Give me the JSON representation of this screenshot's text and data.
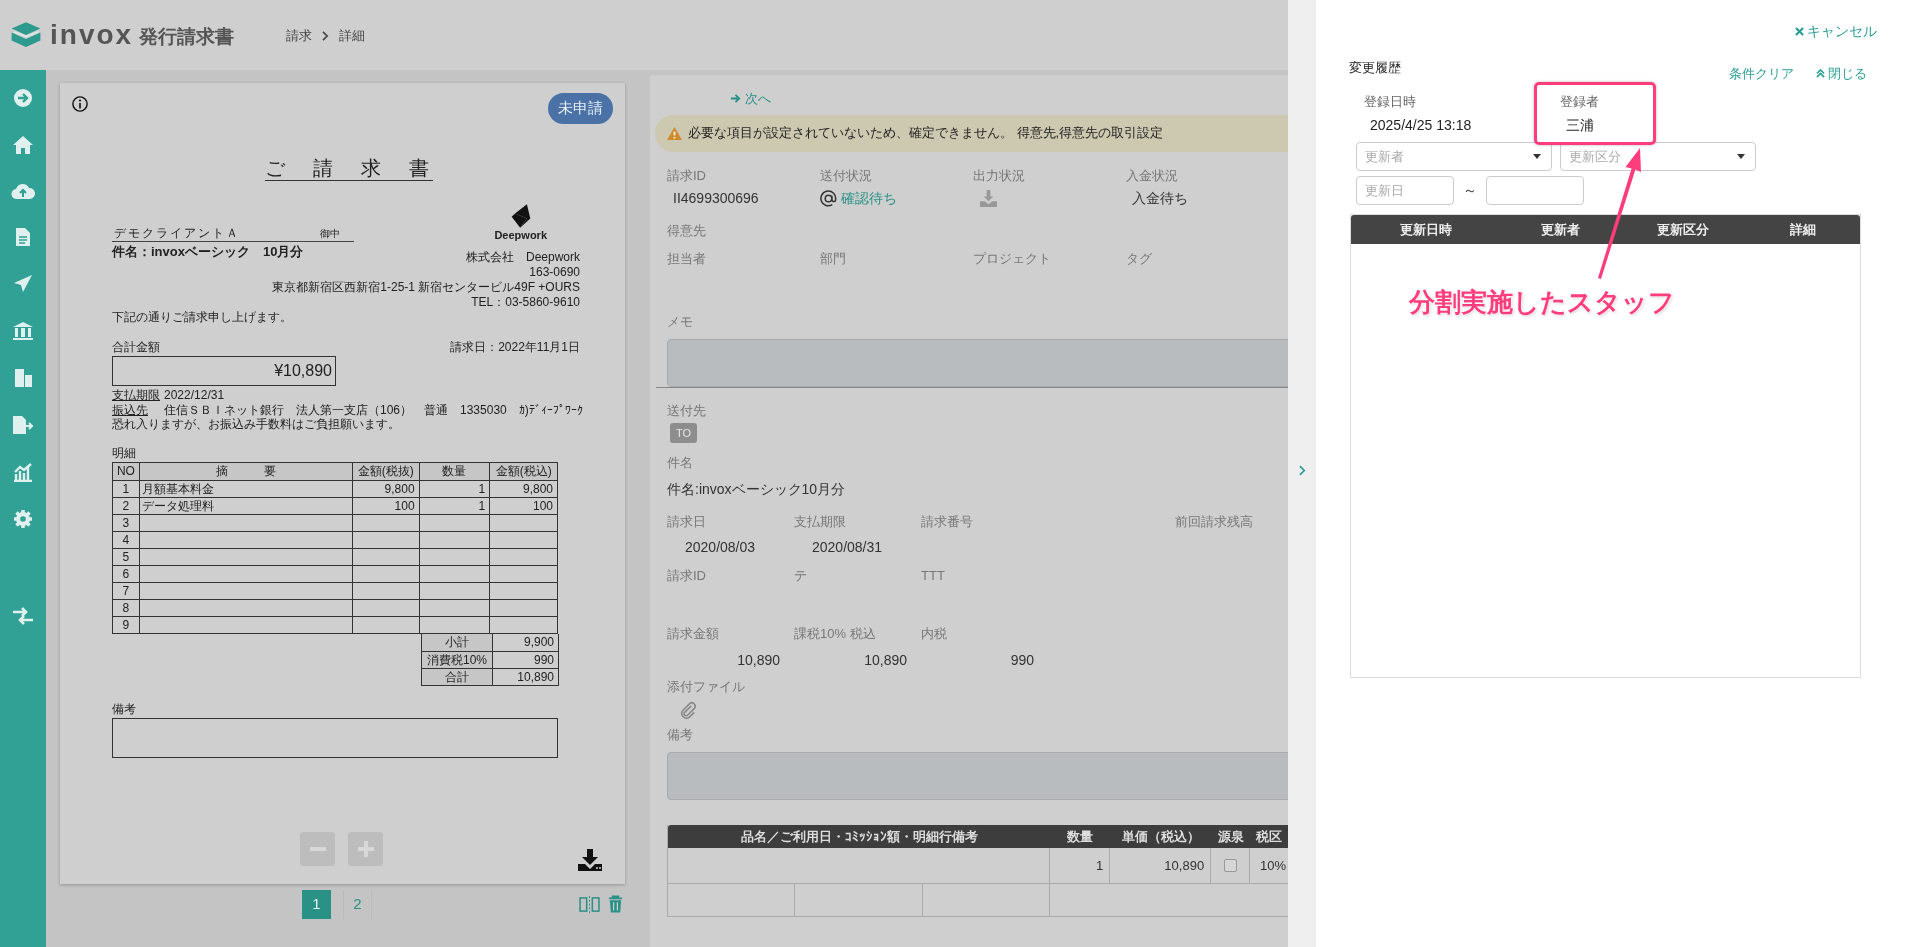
{
  "header": {
    "app_name": "invox",
    "app_subtitle": "発行請求書",
    "breadcrumb": [
      "請求",
      "詳細"
    ]
  },
  "invoice_preview": {
    "status_badge": "未申請",
    "document": {
      "title": "ご　請　求　書",
      "client": "デモクライアントＡ",
      "honorific": "御中",
      "subject": "件名：invoxベーシック　10月分",
      "company_logo_text": "Deepwork",
      "company_lines": [
        "株式会社　Deepwork",
        "163-0690",
        "東京都新宿区西新宿1-25-1 新宿センタービル49F +OURS",
        "TEL：03-5860-9610"
      ],
      "greeting": "下記の通りご請求申し上げます。",
      "total_label": "合計金額",
      "issue_date": "請求日：2022年11月1日",
      "total_amount": "¥10,890",
      "payment_rows": [
        {
          "label": "支払期限",
          "value": "2022/12/31"
        },
        {
          "label": "振込先",
          "value": "住信ＳＢＩネット銀行　法人第一支店（106）　普通　1335030　ｶ)ﾃﾞｨｰﾌﾟﾜｰｸ"
        }
      ],
      "fee_note": "恐れ入りますが、お振込み手数料はご負担願います。",
      "details_label": "明細",
      "table": {
        "columns": [
          "NO",
          "摘　　　要",
          "金額(税抜)",
          "数量",
          "金額(税込)"
        ],
        "rows": [
          {
            "no": "1",
            "description": "月額基本料金",
            "amount_excl": "9,800",
            "quantity": "1",
            "amount_incl": "9,800"
          },
          {
            "no": "2",
            "description": "データ処理料",
            "amount_excl": "100",
            "quantity": "1",
            "amount_incl": "100"
          },
          {
            "no": "3"
          },
          {
            "no": "4"
          },
          {
            "no": "5"
          },
          {
            "no": "6"
          },
          {
            "no": "7"
          },
          {
            "no": "8"
          },
          {
            "no": "9"
          }
        ]
      },
      "summary": [
        {
          "label": "小計",
          "value": "9,900"
        },
        {
          "label": "消費税10%",
          "value": "990"
        },
        {
          "label": "合計",
          "value": "10,890"
        }
      ],
      "remarks_label": "備考"
    },
    "pages": [
      {
        "label": "1",
        "selected": true
      },
      {
        "label": "2",
        "selected": false
      }
    ]
  },
  "detail": {
    "next_link": "次へ",
    "warning": "必要な項目が設定されていないため、確定できません。 得意先,得意先の取引設定",
    "status_fields": [
      {
        "label": "請求ID",
        "kind": "text",
        "value": "II4699300696"
      },
      {
        "label": "送付状況",
        "kind": "link",
        "value": "確認待ち"
      },
      {
        "label": "出力状況",
        "kind": "icon"
      },
      {
        "label": "入金状況",
        "kind": "text",
        "value": "入金待ち"
      }
    ],
    "customer_label": "得意先",
    "assignment_labels": [
      "担当者",
      "部門",
      "プロジェクト",
      "タグ"
    ],
    "memo_label": "メモ",
    "recipients_label": "送付先",
    "recipient_tags": [
      "TO"
    ],
    "subject_label": "件名",
    "subject": "件名:invoxベーシック10月分",
    "date_fields": [
      {
        "label": "請求日",
        "value": "2020/08/03"
      },
      {
        "label": "支払期限",
        "value": "2020/08/31"
      },
      {
        "label": "請求番号"
      },
      {
        "label": "前回請求残高"
      }
    ],
    "custom_labels": [
      "請求ID",
      "テ",
      "TTT"
    ],
    "amount_fields": [
      {
        "label": "請求金額",
        "value": "10,890"
      },
      {
        "label": "課税10% 税込",
        "value": "10,890"
      },
      {
        "label": "内税",
        "value": "990"
      }
    ],
    "attachments_label": "添付ファイル",
    "remarks_label": "備考",
    "line_items": {
      "columns": [
        "品名／ご利用日・ｺﾐｯｼｮﾝ額・明細行備考",
        "数量",
        "単価（税込）",
        "源泉",
        "税区"
      ],
      "rows": [
        {
          "quantity": "1",
          "unit_price": "10,890",
          "withholding": false,
          "tax": "10%"
        }
      ]
    }
  },
  "history_panel": {
    "cancel": "キャンセル",
    "title": "変更履歴",
    "clear": "条件クリア",
    "close": "閉じる",
    "created_at_label": "登録日時",
    "created_at": "2025/4/25 13:18",
    "creator_label": "登録者",
    "creator": "三浦",
    "filters": {
      "updater_placeholder": "更新者",
      "category_placeholder": "更新区分",
      "date_from_placeholder": "更新日",
      "range_separator": "～"
    },
    "table": {
      "columns": [
        "更新日時",
        "更新者",
        "更新区分",
        "詳細"
      ]
    },
    "annotation": {
      "text": "分割実施したスタッフ"
    }
  }
}
